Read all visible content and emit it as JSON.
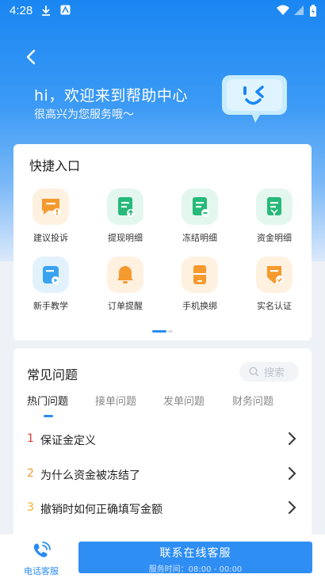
{
  "status": {
    "time": "4:28"
  },
  "hero": {
    "title": "hi，欢迎来到帮助中心",
    "subtitle": "很高兴为您服务哦～"
  },
  "shortcuts": {
    "title": "快捷入口",
    "items": [
      {
        "label": "建议投诉",
        "icon": "complaint-icon",
        "color": "#f59a2e"
      },
      {
        "label": "提现明细",
        "icon": "withdraw-detail-icon",
        "color": "#27b979"
      },
      {
        "label": "冻结明细",
        "icon": "freeze-detail-icon",
        "color": "#27b979"
      },
      {
        "label": "资金明细",
        "icon": "fund-detail-icon",
        "color": "#27b979"
      },
      {
        "label": "新手教学",
        "icon": "tutorial-icon",
        "color": "#3aa3f0"
      },
      {
        "label": "订单提醒",
        "icon": "bell-icon",
        "color": "#f59a2e"
      },
      {
        "label": "手机换绑",
        "icon": "phone-rebind-icon",
        "color": "#f59a2e"
      },
      {
        "label": "实名认证",
        "icon": "verify-icon",
        "color": "#f59a2e"
      }
    ]
  },
  "faq": {
    "title": "常见问题",
    "search_placeholder": "搜索",
    "tabs": [
      "热门问题",
      "接单问题",
      "发单问题",
      "财务问题"
    ],
    "active_tab": 0,
    "questions": [
      {
        "num": "1",
        "text": "保证金定义",
        "color": "#e63a2e"
      },
      {
        "num": "2",
        "text": "为什么资金被冻结了",
        "color": "#f59a2e"
      },
      {
        "num": "3",
        "text": "撤销时如何正确填写金额",
        "color": "#f2b01e"
      }
    ]
  },
  "bottom": {
    "phone_label": "电话客服",
    "cta_label": "联系在线客服",
    "cta_hours": "服务时间：08:00 - 00:00"
  },
  "colors": {
    "accent": "#2a8cf3"
  }
}
